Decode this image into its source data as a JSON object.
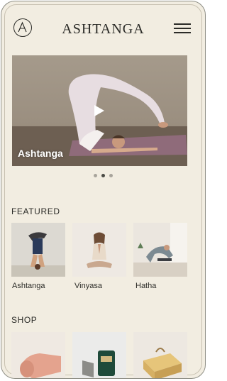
{
  "header": {
    "brand": "ASHTANGA",
    "logo_letter": "A"
  },
  "hero": {
    "title": "Ashtanga",
    "carousel": {
      "count": 3,
      "active": 2
    }
  },
  "featured": {
    "title": "FEATURED",
    "items": [
      {
        "label": "Ashtanga"
      },
      {
        "label": "Vinyasa"
      },
      {
        "label": "Hatha"
      }
    ]
  },
  "shop": {
    "title": "SHOP"
  },
  "icons": {
    "menu": "hamburger-menu-icon",
    "play": "play-icon",
    "logo": "logo-icon"
  },
  "colors": {
    "background": "#f2ede1",
    "text": "#2c2c28"
  }
}
